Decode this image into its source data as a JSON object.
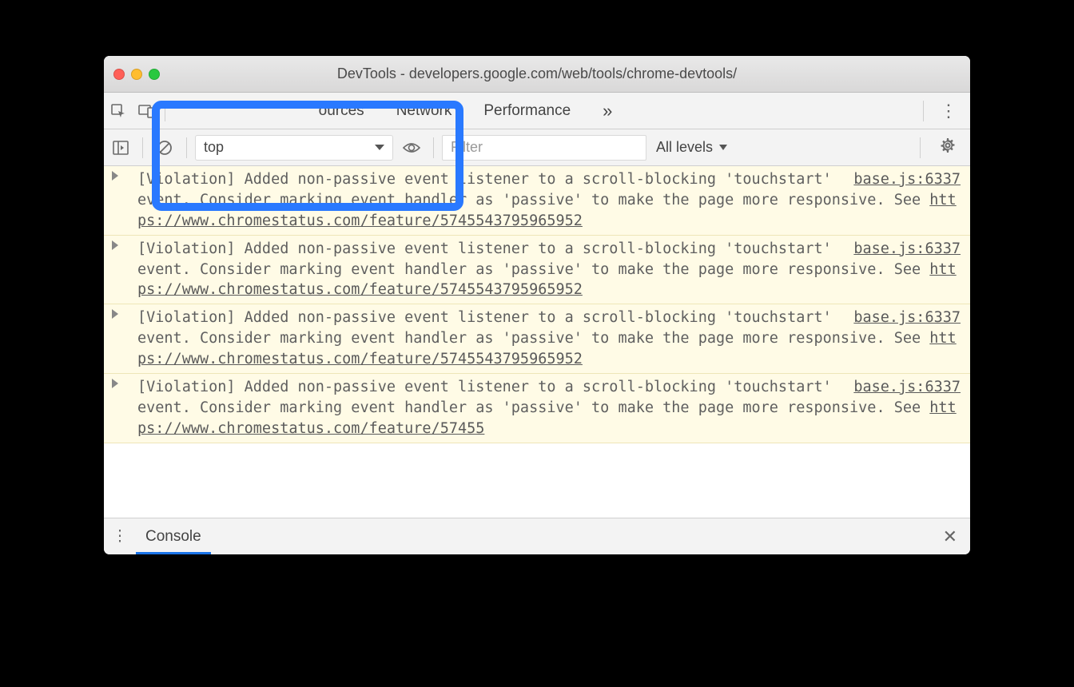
{
  "window": {
    "title": "DevTools - developers.google.com/web/tools/chrome-devtools/"
  },
  "tabs": {
    "sources": "ources",
    "network": "Network",
    "performance": "Performance",
    "more": "»"
  },
  "consoleBar": {
    "context": "top",
    "filter_placeholder": "Filter",
    "levels": "All levels"
  },
  "drawer": {
    "tab": "Console"
  },
  "violation": {
    "source": "base.js:6337",
    "prefix": "[Violation] Added non-passive event listener to a scroll-blocking 'touchstart' event. Consider marking event handler as 'passive' to make the page more responsive. See ",
    "link": "https://www.chromestatus.com/feature/5745543795965952",
    "prefix_partial": "[Violation] Added non-passive event listener to a scroll-blocking 'touchstart' event. Consider marking event handler as 'passive' to make the page more responsive. See ",
    "link_partial": "https://www.chromestatus.com/feature/57455"
  }
}
